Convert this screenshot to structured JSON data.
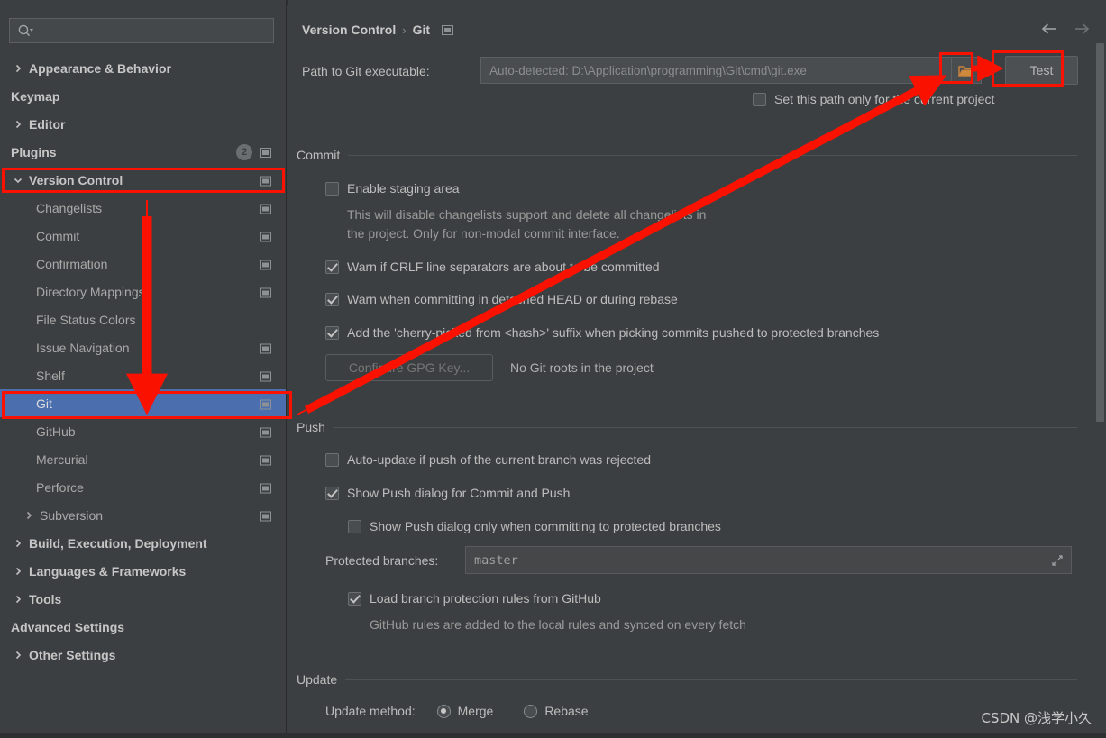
{
  "sidebar": {
    "search": {
      "placeholder": "",
      "icon": "search-icon"
    },
    "items": [
      {
        "label": "Appearance & Behavior",
        "level": 0,
        "twisty": "right",
        "badge": null,
        "cfg": false
      },
      {
        "label": "Keymap",
        "level": 0,
        "twisty": "none",
        "badge": null,
        "cfg": false
      },
      {
        "label": "Editor",
        "level": 0,
        "twisty": "right",
        "badge": null,
        "cfg": false
      },
      {
        "label": "Plugins",
        "level": 0,
        "twisty": "none",
        "badge": "2",
        "cfg": true
      },
      {
        "label": "Version Control",
        "level": 0,
        "twisty": "down",
        "badge": null,
        "cfg": true
      },
      {
        "label": "Changelists",
        "level": 1,
        "twisty": "none",
        "badge": null,
        "cfg": true
      },
      {
        "label": "Commit",
        "level": 1,
        "twisty": "none",
        "badge": null,
        "cfg": true
      },
      {
        "label": "Confirmation",
        "level": 1,
        "twisty": "none",
        "badge": null,
        "cfg": true
      },
      {
        "label": "Directory Mappings",
        "level": 1,
        "twisty": "none",
        "badge": null,
        "cfg": true
      },
      {
        "label": "File Status Colors",
        "level": 1,
        "twisty": "none",
        "badge": null,
        "cfg": false
      },
      {
        "label": "Issue Navigation",
        "level": 1,
        "twisty": "none",
        "badge": null,
        "cfg": true
      },
      {
        "label": "Shelf",
        "level": 1,
        "twisty": "none",
        "badge": null,
        "cfg": true
      },
      {
        "label": "Git",
        "level": 1,
        "twisty": "none",
        "badge": null,
        "cfg": true,
        "selected": true
      },
      {
        "label": "GitHub",
        "level": 1,
        "twisty": "none",
        "badge": null,
        "cfg": true
      },
      {
        "label": "Mercurial",
        "level": 1,
        "twisty": "none",
        "badge": null,
        "cfg": true
      },
      {
        "label": "Perforce",
        "level": 1,
        "twisty": "none",
        "badge": null,
        "cfg": true
      },
      {
        "label": "Subversion",
        "level": 1,
        "twisty": "right",
        "badge": null,
        "cfg": true
      },
      {
        "label": "Build, Execution, Deployment",
        "level": 0,
        "twisty": "right",
        "badge": null,
        "cfg": false
      },
      {
        "label": "Languages & Frameworks",
        "level": 0,
        "twisty": "right",
        "badge": null,
        "cfg": false
      },
      {
        "label": "Tools",
        "level": 0,
        "twisty": "right",
        "badge": null,
        "cfg": false
      },
      {
        "label": "Advanced Settings",
        "level": 0,
        "twisty": "none",
        "badge": null,
        "cfg": false
      },
      {
        "label": "Other Settings",
        "level": 0,
        "twisty": "right",
        "badge": null,
        "cfg": false
      }
    ]
  },
  "header": {
    "breadcrumb_root": "Version Control",
    "breadcrumb_sep": "›",
    "breadcrumb_leaf": "Git",
    "back_arrow": "←",
    "forward_arrow": "→"
  },
  "path_row": {
    "label": "Path to Git executable:",
    "value": "",
    "placeholder": "Auto-detected: D:\\Application\\programming\\Git\\cmd\\git.exe",
    "browse_icon": "folder-icon",
    "test_label": "Test",
    "only_current_project": "Set this path only for the current project",
    "only_current_project_checked": false
  },
  "commit": {
    "section_title": "Commit",
    "enable_staging_label": "Enable staging area",
    "enable_staging_checked": false,
    "enable_staging_hint_1": "This will disable changelists support and delete all changelists in",
    "enable_staging_hint_2": "the project. Only for non-modal commit interface.",
    "warn_crlf_label": "Warn if CRLF line separators are about to be committed",
    "warn_crlf_checked": true,
    "warn_detached_label": "Warn when committing in detached HEAD or during rebase",
    "warn_detached_checked": true,
    "cherry_pick_label": "Add the 'cherry-picked from <hash>' suffix when picking commits pushed to protected branches",
    "cherry_pick_checked": true,
    "gpg_button": "Configure GPG Key...",
    "gpg_note": "No Git roots in the project"
  },
  "push": {
    "section_title": "Push",
    "auto_update_label": "Auto-update if push of the current branch was rejected",
    "auto_update_checked": false,
    "show_push_dialog_label": "Show Push dialog for Commit and Push",
    "show_push_dialog_checked": true,
    "show_push_protected_label": "Show Push dialog only when committing to protected branches",
    "show_push_protected_checked": false,
    "protected_branches_label": "Protected branches:",
    "protected_branches_value": "master",
    "load_rules_label": "Load branch protection rules from GitHub",
    "load_rules_checked": true,
    "load_rules_hint": "GitHub rules are added to the local rules and synced on every fetch"
  },
  "update": {
    "section_title": "Update",
    "method_label": "Update method:",
    "option_merge": "Merge",
    "option_rebase": "Rebase",
    "selected": "Merge"
  },
  "watermark": "CSDN @浅学小久",
  "colors": {
    "background": "#3c3f41",
    "selection": "#4b6eaf",
    "annotation": "#fb1100",
    "text": "#bdbdbd",
    "muted_text": "#9a9a9a"
  }
}
